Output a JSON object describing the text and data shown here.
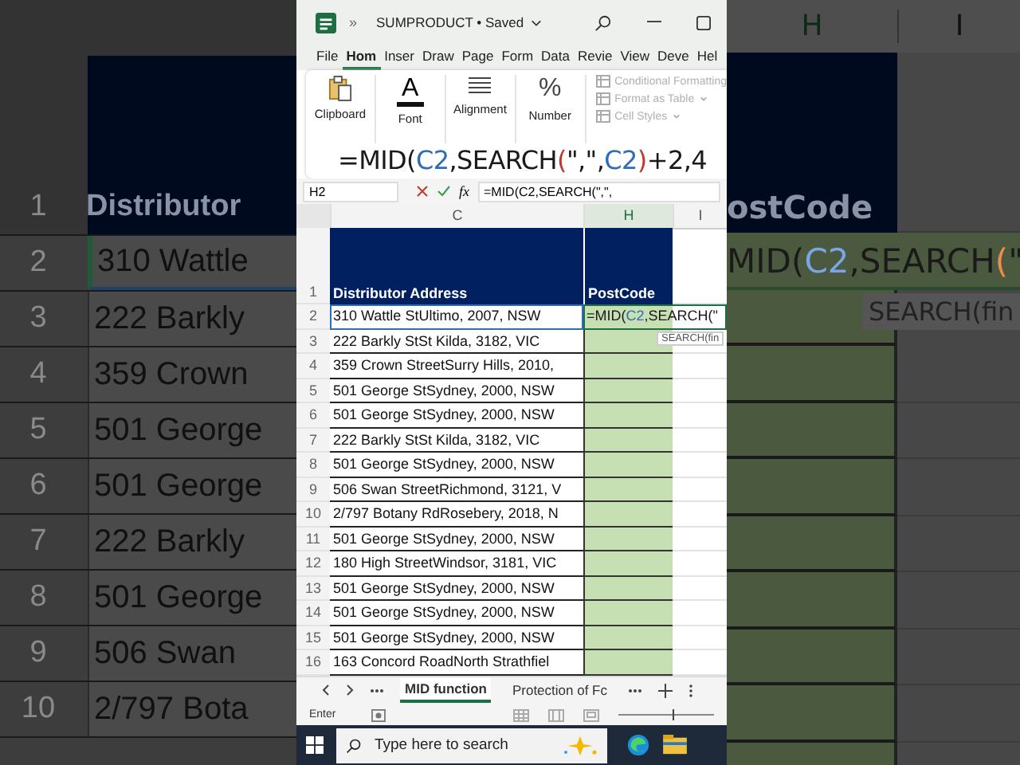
{
  "backdrop_left": {
    "header": {
      "number": "1",
      "text": "Distributor"
    },
    "rows": [
      {
        "number": "2",
        "text": "310 Wattle",
        "selected": true
      },
      {
        "number": "3",
        "text": "222 Barkly",
        "selected": false
      },
      {
        "number": "4",
        "text": "359 Crown",
        "selected": false
      },
      {
        "number": "5",
        "text": "501 George",
        "selected": false
      },
      {
        "number": "6",
        "text": "501 George",
        "selected": false
      },
      {
        "number": "7",
        "text": "222 Barkly",
        "selected": false
      },
      {
        "number": "8",
        "text": "501 George",
        "selected": false
      },
      {
        "number": "9",
        "text": "506 Swan",
        "selected": false
      },
      {
        "number": "10",
        "text": "2/797 Bota",
        "selected": false
      }
    ]
  },
  "title_bar": {
    "app_glyph": "»",
    "title": "SUMPRODUCT • Saved"
  },
  "menu_tabs": [
    {
      "label": "File",
      "selected": false
    },
    {
      "label": "Hom",
      "selected": true
    },
    {
      "label": "Inser",
      "selected": false
    },
    {
      "label": "Draw",
      "selected": false
    },
    {
      "label": "Page",
      "selected": false
    },
    {
      "label": "Form",
      "selected": false
    },
    {
      "label": "Data",
      "selected": false
    },
    {
      "label": "Revie",
      "selected": false
    },
    {
      "label": "View",
      "selected": false
    },
    {
      "label": "Deve",
      "selected": false
    },
    {
      "label": "Hel",
      "selected": false
    }
  ],
  "ribbon": {
    "groups": [
      {
        "label": "Clipboard",
        "kind": "clipboard"
      },
      {
        "label": "Font",
        "kind": "font",
        "glyph": "A"
      },
      {
        "label": "Alignment",
        "kind": "alignment"
      },
      {
        "label": "Number",
        "kind": "number",
        "glyph": "%"
      }
    ],
    "style_commands": [
      {
        "label": "Conditional Formatting",
        "dropdown": false,
        "disabled": true
      },
      {
        "label": "Format as Table",
        "dropdown": true,
        "disabled": true
      },
      {
        "label": "Cell Styles",
        "dropdown": true,
        "disabled": true
      }
    ]
  },
  "caption": {
    "segments": [
      {
        "text": "=MID(",
        "color": "#1a1a1a"
      },
      {
        "text": "C2",
        "color": "#2f6db5"
      },
      {
        "text": ",SEARCH",
        "color": "#1a1a1a"
      },
      {
        "text": "(",
        "color": "#c0392b"
      },
      {
        "text": "\",\",",
        "color": "#1a1a1a"
      },
      {
        "text": "C2",
        "color": "#2f6db5"
      },
      {
        "text": ")",
        "color": "#c0392b"
      },
      {
        "text": "+2,4",
        "color": "#1a1a1a"
      }
    ]
  },
  "formula_bar": {
    "name_box": "H2",
    "fx": "fx",
    "formula": "=MID(C2,SEARCH(\",\","
  },
  "sheet": {
    "columns": [
      {
        "label": "C",
        "selected": false
      },
      {
        "label": "H",
        "selected": true
      },
      {
        "label": "I",
        "selected": false
      }
    ],
    "header_row": {
      "number": "1",
      "cells": [
        "Distributor Address",
        "PostCode"
      ]
    },
    "editing_formula": [
      {
        "text": "=MID(",
        "color": "#1a1a1a"
      },
      {
        "text": "C2",
        "color": "#2f6db5"
      },
      {
        "text": ",SEARCH(\"",
        "color": "#1a1a1a"
      }
    ],
    "tooltip": "SEARCH(fin",
    "rows": [
      {
        "number": "2",
        "address": "310 Wattle StUltimo, 2007, NSW",
        "selected": true
      },
      {
        "number": "3",
        "address": "222 Barkly StSt Kilda, 3182, VIC",
        "selected": false
      },
      {
        "number": "4",
        "address": "359 Crown StreetSurry Hills, 2010,",
        "selected": false
      },
      {
        "number": "5",
        "address": "501 George StSydney, 2000, NSW",
        "selected": false
      },
      {
        "number": "6",
        "address": "501 George StSydney, 2000, NSW",
        "selected": false
      },
      {
        "number": "7",
        "address": "222 Barkly StSt Kilda, 3182, VIC",
        "selected": false
      },
      {
        "number": "8",
        "address": "501 George StSydney, 2000, NSW",
        "selected": false
      },
      {
        "number": "9",
        "address": "506 Swan StreetRichmond, 3121, V",
        "selected": false
      },
      {
        "number": "10",
        "address": "2/797 Botany RdRosebery, 2018, N",
        "selected": false
      },
      {
        "number": "11",
        "address": "501 George StSydney, 2000, NSW",
        "selected": false
      },
      {
        "number": "12",
        "address": "180 High StreetWindsor, 3181, VIC",
        "selected": false
      },
      {
        "number": "13",
        "address": "501 George StSydney, 2000, NSW",
        "selected": false
      },
      {
        "number": "14",
        "address": "501 George StSydney, 2000, NSW",
        "selected": false
      },
      {
        "number": "15",
        "address": "501 George StSydney, 2000, NSW",
        "selected": false
      },
      {
        "number": "16",
        "address": "163 Concord RoadNorth Strathfiel",
        "selected": false
      }
    ]
  },
  "sheet_tabs": [
    {
      "label": "MID function",
      "selected": true
    },
    {
      "label": "Protection of Fc",
      "selected": false
    }
  ],
  "status_bar": {
    "mode": "Enter",
    "zoom": {
      "level": 0.56
    }
  },
  "taskbar": {
    "search_placeholder": "Type here to search"
  },
  "backdrop_right": {
    "columns": [
      "H",
      "I"
    ],
    "header": "ostCode",
    "formula": [
      {
        "text": "MID(",
        "color": "#1a1a1a"
      },
      {
        "text": "C2",
        "color": "#7aa6e8"
      },
      {
        "text": ",SEARCH",
        "color": "#1a1a1a"
      },
      {
        "text": "(",
        "color": "#f08a50"
      },
      {
        "text": "\"",
        "color": "#1a1a1a"
      }
    ],
    "tooltip": "SEARCH(fin"
  }
}
